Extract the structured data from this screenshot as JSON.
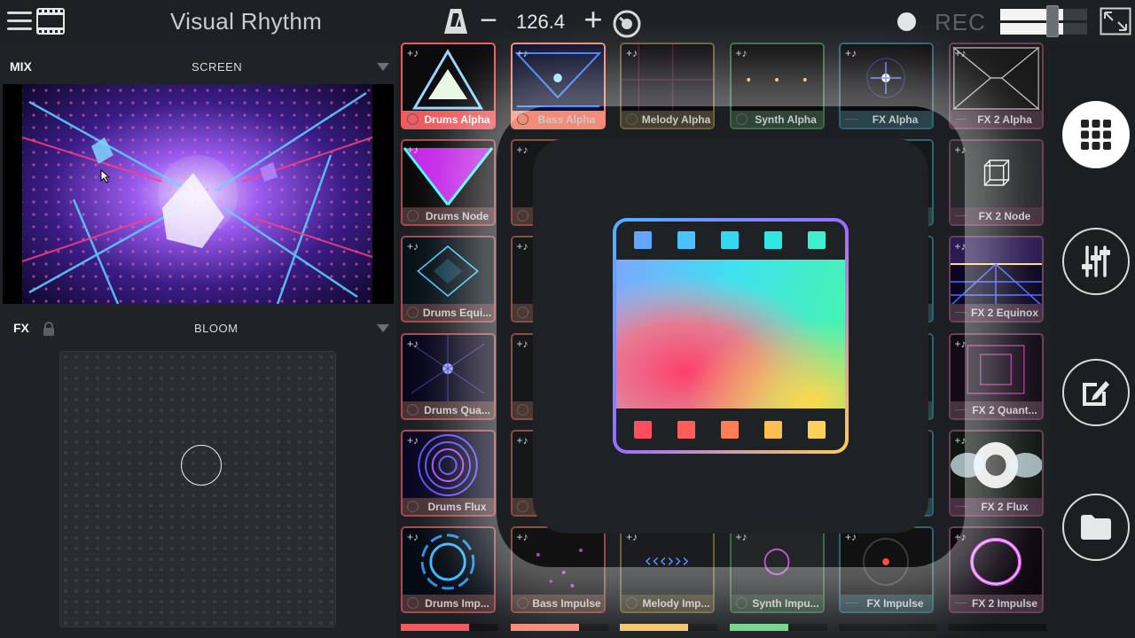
{
  "header": {
    "title": "Visual Rhythm",
    "bpm": "126.4",
    "bpm_minus": "−",
    "bpm_plus": "+",
    "rec_label": "REC",
    "crossfader_level": 0.6
  },
  "mix": {
    "label": "MIX",
    "blend_mode": "SCREEN"
  },
  "fx": {
    "label": "FX",
    "effect": "BLOOM",
    "pad_x": 0.51,
    "pad_y": 0.41
  },
  "clips": [
    [
      {
        "label": "Drums Alpha",
        "group": "drums",
        "active": true
      },
      {
        "label": "Drums Node",
        "group": "drums"
      },
      {
        "label": "Drums Equi...",
        "group": "drums"
      },
      {
        "label": "Drums Qua...",
        "group": "drums"
      },
      {
        "label": "Drums Flux",
        "group": "drums"
      },
      {
        "label": "Drums Imp...",
        "group": "drums"
      }
    ],
    [
      {
        "label": "Bass Alpha",
        "group": "bass",
        "active": true
      },
      {
        "label": "",
        "group": "bass"
      },
      {
        "label": "",
        "group": "bass"
      },
      {
        "label": "",
        "group": "bass"
      },
      {
        "label": "",
        "group": "bass"
      },
      {
        "label": "Bass Impulse",
        "group": "bass"
      }
    ],
    [
      {
        "label": "Melody Alpha",
        "group": "melody"
      },
      {
        "label": "",
        "group": "melody"
      },
      {
        "label": "",
        "group": "melody"
      },
      {
        "label": "",
        "group": "melody"
      },
      {
        "label": "",
        "group": "melody"
      },
      {
        "label": "Melody Imp...",
        "group": "melody"
      }
    ],
    [
      {
        "label": "Synth Alpha",
        "group": "synth"
      },
      {
        "label": "",
        "group": "synth"
      },
      {
        "label": "",
        "group": "synth"
      },
      {
        "label": "",
        "group": "synth"
      },
      {
        "label": "",
        "group": "synth"
      },
      {
        "label": "Synth Impu...",
        "group": "synth"
      }
    ],
    [
      {
        "label": "FX Alpha",
        "group": "fx"
      },
      {
        "label": "",
        "group": "fx"
      },
      {
        "label": "",
        "group": "fx"
      },
      {
        "label": "",
        "group": "fx"
      },
      {
        "label": "",
        "group": "fx"
      },
      {
        "label": "FX Impulse",
        "group": "fx"
      }
    ],
    [
      {
        "label": "FX 2 Alpha",
        "group": "fx2"
      },
      {
        "label": "FX 2 Node",
        "group": "fx2"
      },
      {
        "label": "FX 2 Equinox",
        "group": "fx2"
      },
      {
        "label": "FX 2 Quant...",
        "group": "fx2"
      },
      {
        "label": "FX 2 Flux",
        "group": "fx2"
      },
      {
        "label": "FX 2 Impulse",
        "group": "fx2"
      }
    ]
  ],
  "column_levels": [
    0.7,
    0.7,
    0.7,
    0.6,
    0,
    0
  ],
  "colors": {
    "drums": "#ef5b5e",
    "bass": "#f38c77",
    "melody": "#f6c46a",
    "synth": "#6fd48a",
    "fx": "#3fb3c9",
    "fx2": "#d37bb6"
  },
  "sidebar": [
    "grid-icon",
    "mixer-sliders-icon",
    "edit-icon",
    "folder-icon"
  ],
  "overlay": {
    "icon": "film-strip-logo-icon"
  }
}
